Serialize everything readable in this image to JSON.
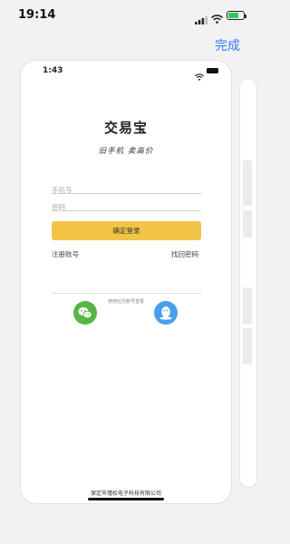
{
  "status_bar": {
    "time": "19:14"
  },
  "nav": {
    "done_label": "完成"
  },
  "preview": {
    "status_time": "1:43",
    "logo": "交易宝",
    "slogan": "旧手机 卖高价",
    "phone_placeholder": "手机号",
    "password_placeholder": "密码",
    "login_label": "确定登录",
    "register_label": "注册账号",
    "forgot_label": "找回密码",
    "social_login_label": "使用社交账号登录",
    "footer": "保定市瑾松电子科技有限公司"
  },
  "colors": {
    "accent": "#2f7cf6",
    "login_button": "#f1c445",
    "wechat": "#57b545",
    "qq": "#4aa0e8"
  },
  "icons": [
    "cellular-signal-icon",
    "wifi-icon",
    "battery-icon",
    "wechat-icon",
    "qq-icon"
  ]
}
